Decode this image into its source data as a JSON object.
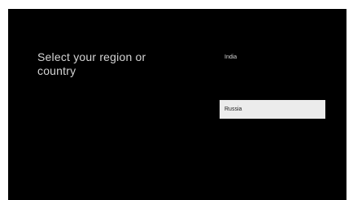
{
  "screen": {
    "title": "Select your region or country"
  },
  "regions": {
    "items": [
      {
        "label": "India"
      },
      {
        "label": ""
      },
      {
        "label": "Russia"
      },
      {
        "label": ""
      },
      {
        "label": ""
      },
      {
        "label": ""
      }
    ],
    "selected_index": 2
  },
  "colors": {
    "background": "#000000",
    "selected_background": "#ececec",
    "selected_text": "#202020",
    "text": "#d8d8d8"
  }
}
